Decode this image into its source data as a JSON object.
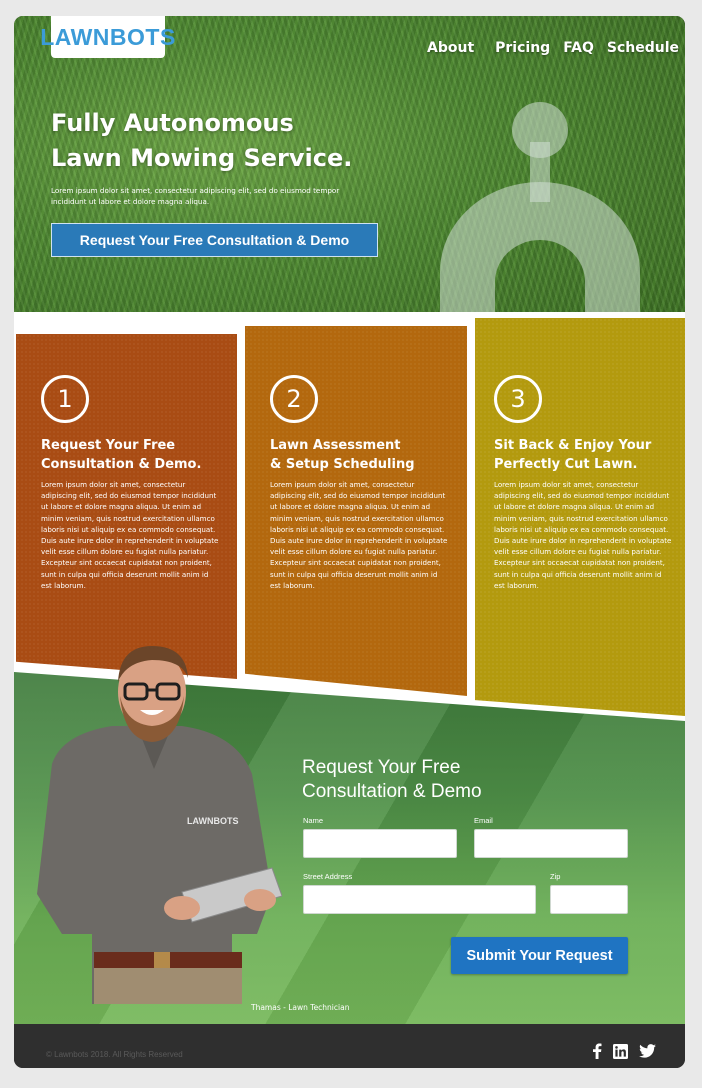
{
  "brand": {
    "logo": "LAWNBOTS"
  },
  "nav": {
    "items": [
      "About",
      "Pricing",
      "FAQ",
      "Schedule"
    ]
  },
  "hero": {
    "title_line1": "Fully Autonomous",
    "title_line2": "Lawn Mowing Service.",
    "subtitle": "Lorem ipsum dolor sit amet, consectetur adipiscing elit, sed do eiusmod tempor incididunt ut labore et dolore magna aliqua.",
    "cta_label": "Request Your Free Consultation & Demo"
  },
  "steps": [
    {
      "number": "1",
      "title_line1": "Request Your Free",
      "title_line2": "Consultation & Demo.",
      "body": "Lorem ipsum dolor sit amet, consectetur adipiscing elit, sed do eiusmod tempor incididunt ut labore et dolore magna aliqua. Ut enim ad minim veniam, quis nostrud exercitation ullamco laboris nisi ut aliquip ex ea commodo consequat. Duis aute irure dolor in reprehenderit in voluptate velit esse cillum dolore eu fugiat nulla pariatur. Excepteur sint occaecat cupidatat non proident, sunt in culpa qui officia deserunt mollit anim id est laborum.",
      "color": "#a94c14"
    },
    {
      "number": "2",
      "title_line1": "Lawn Assessment",
      "title_line2": "& Setup Scheduling",
      "body": "Lorem ipsum dolor sit amet, consectetur adipiscing elit, sed do eiusmod tempor incididunt ut labore et dolore magna aliqua. Ut enim ad minim veniam, quis nostrud exercitation ullamco laboris nisi ut aliquip ex ea commodo consequat. Duis aute irure dolor in reprehenderit in voluptate velit esse cillum dolore eu fugiat nulla pariatur. Excepteur sint occaecat cupidatat non proident, sunt in culpa qui officia deserunt mollit anim id est laborum.",
      "color": "#b3680e"
    },
    {
      "number": "3",
      "title_line1": "Sit Back & Enjoy Your",
      "title_line2": "Perfectly Cut Lawn.",
      "body": "Lorem ipsum dolor sit amet, consectetur adipiscing elit, sed do eiusmod tempor incididunt ut labore et dolore magna aliqua. Ut enim ad minim veniam, quis nostrud exercitation ullamco laboris nisi ut aliquip ex ea commodo consequat. Duis aute irure dolor in reprehenderit in voluptate velit esse cillum dolore eu fugiat nulla pariatur. Excepteur sint occaecat cupidatat non proident, sunt in culpa qui officia deserunt mollit anim id est laborum.",
      "color": "#b39a0e"
    }
  ],
  "form": {
    "title_line1": "Request Your Free",
    "title_line2": "Consultation & Demo",
    "name_label": "Name",
    "name_value": "",
    "email_label": "Email",
    "email_value": "",
    "address_label": "Street Address",
    "address_value": "",
    "zip_label": "Zip",
    "zip_value": "",
    "submit_label": "Submit Your Request",
    "accent": "#1f74c2"
  },
  "person": {
    "shirt_logo": "LAWNBOTS",
    "caption": "Thamas - Lawn Technician"
  },
  "footer": {
    "copyright": "© Lawnbots 2018. All Rights Reserved",
    "social_icons": [
      "facebook-icon",
      "linkedin-icon",
      "twitter-icon"
    ]
  }
}
